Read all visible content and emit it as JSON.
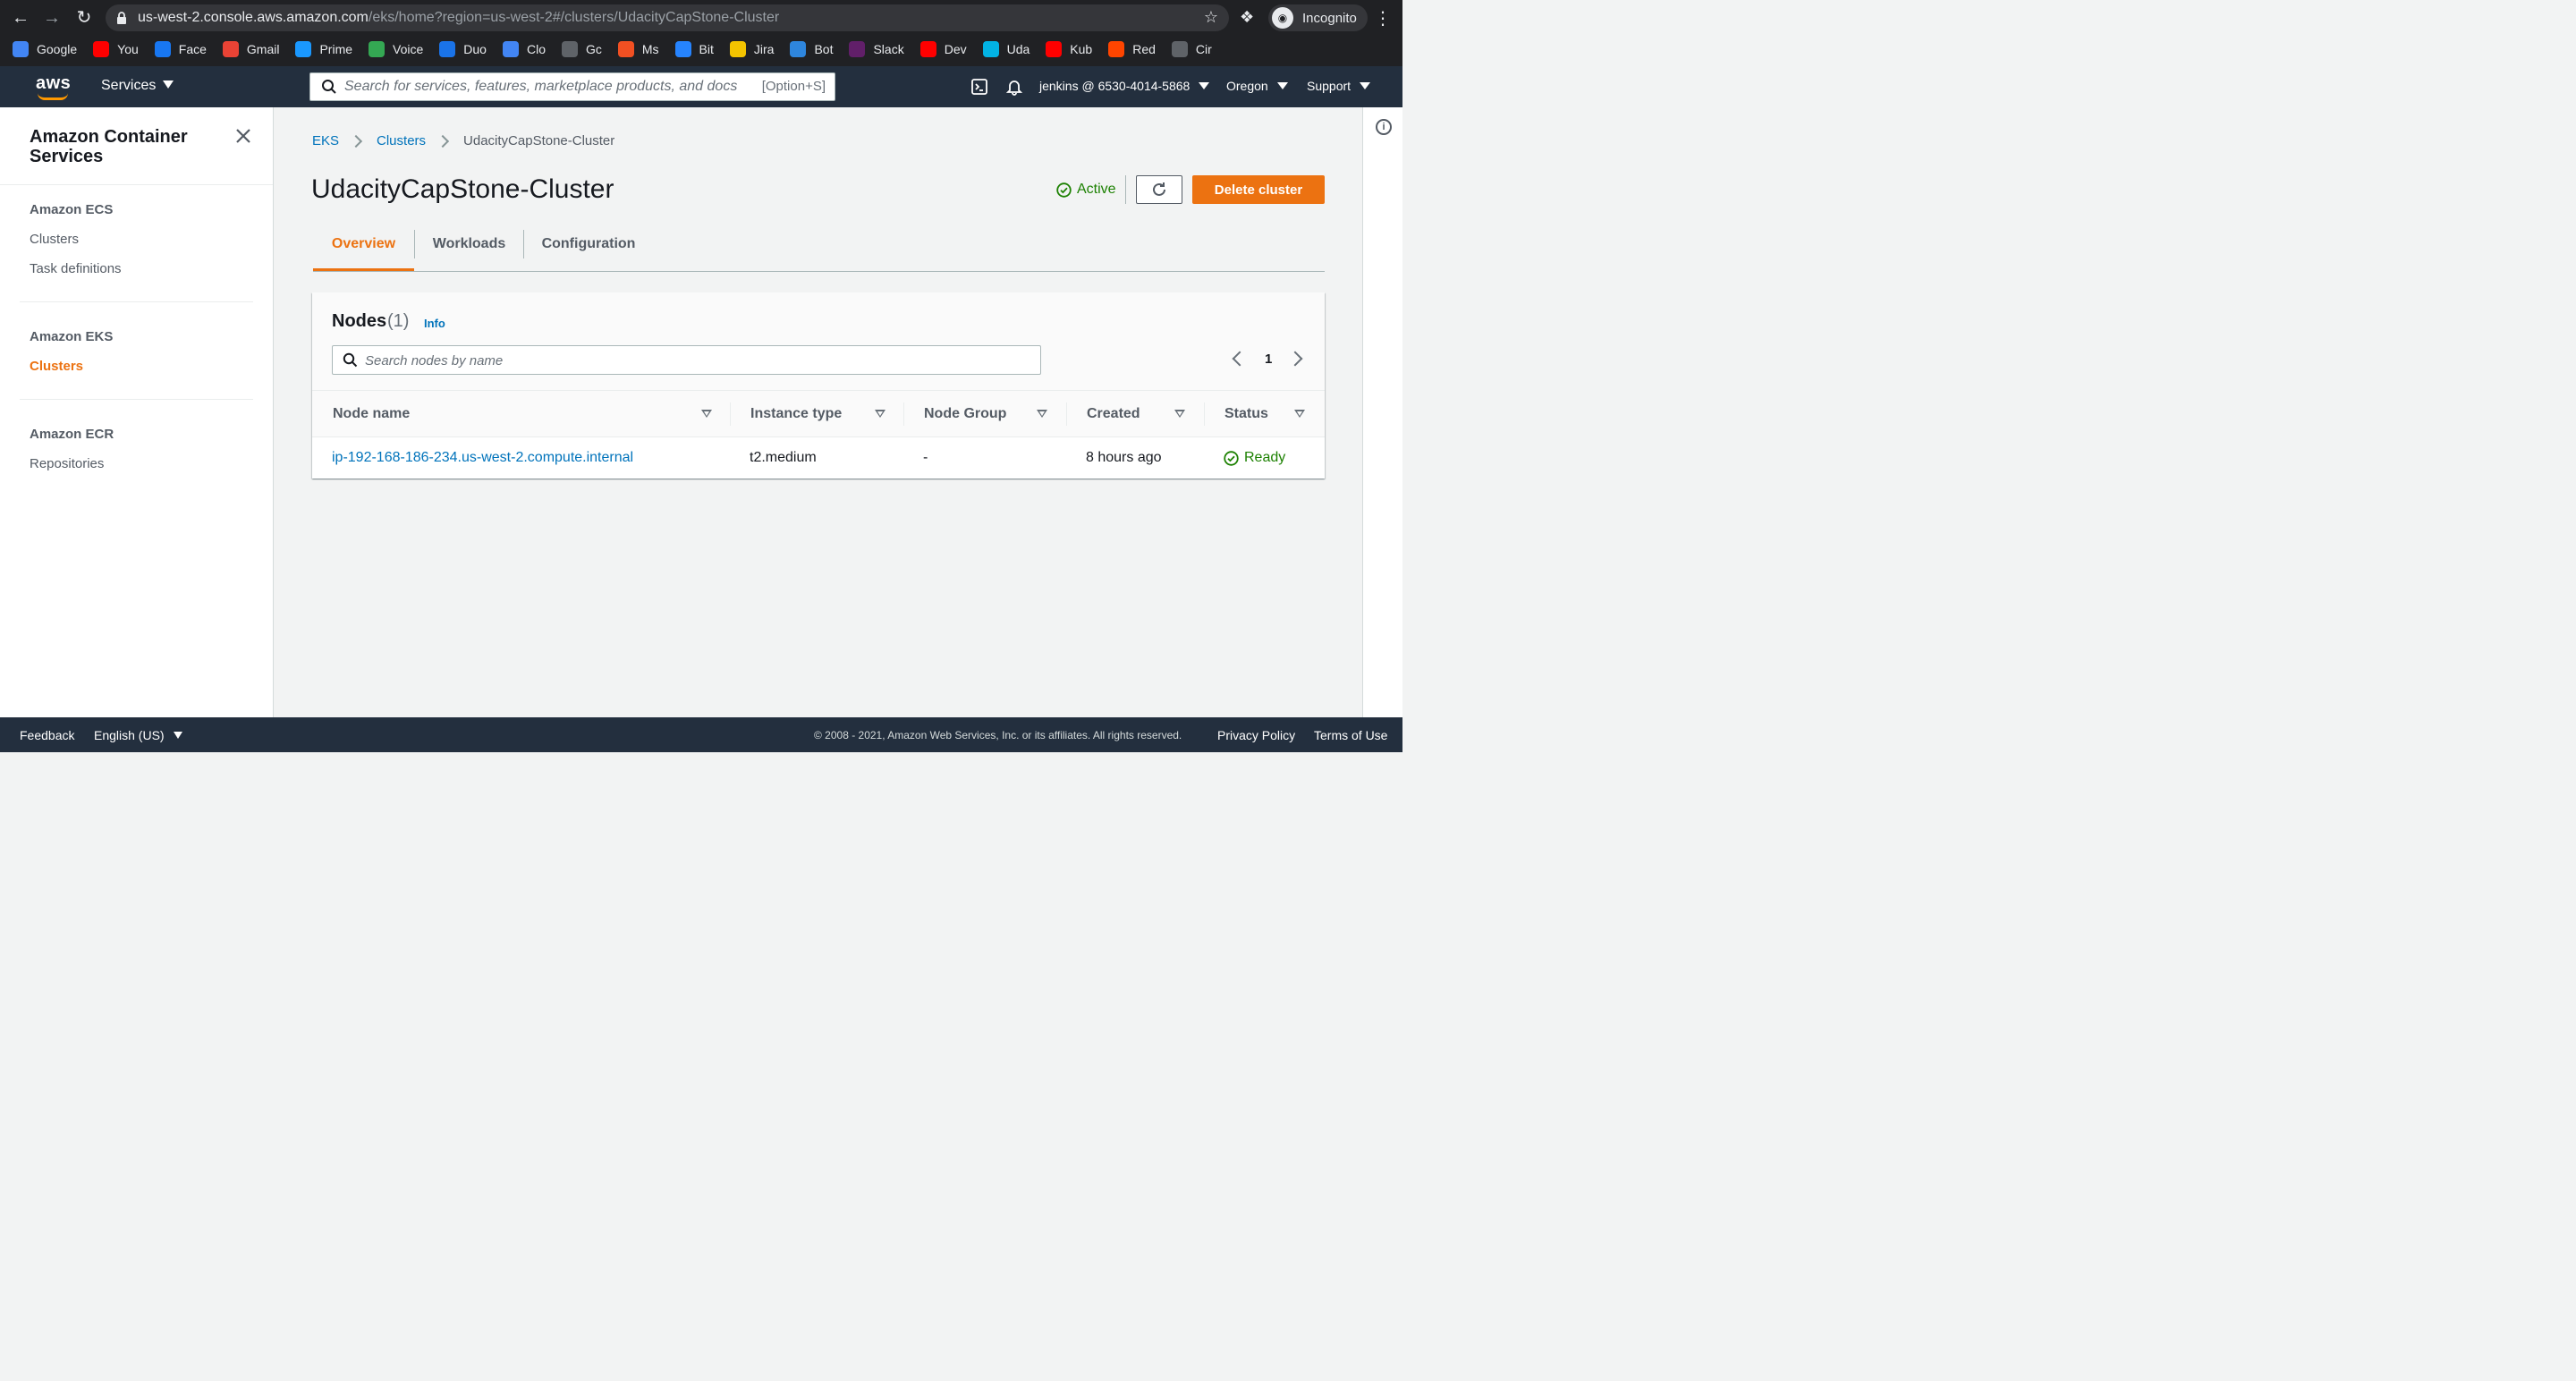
{
  "browser": {
    "url_host": "us-west-2.console.aws.amazon.com",
    "url_path": "/eks/home?region=us-west-2#/clusters/UdacityCapStone-Cluster",
    "incognito_label": "Incognito",
    "bookmarks": [
      {
        "label": "Google",
        "icon": "google-icon",
        "color": "#4285f4"
      },
      {
        "label": "You",
        "icon": "youtube-icon",
        "color": "#ff0000"
      },
      {
        "label": "Face",
        "icon": "facebook-icon",
        "color": "#1877f2"
      },
      {
        "label": "Gmail",
        "icon": "gmail-icon",
        "color": "#ea4335"
      },
      {
        "label": "Prime",
        "icon": "prime-icon",
        "color": "#1a98ff"
      },
      {
        "label": "Voice",
        "icon": "voice-icon",
        "color": "#34a853"
      },
      {
        "label": "Duo",
        "icon": "duo-icon",
        "color": "#1a73e8"
      },
      {
        "label": "Clo",
        "icon": "cloud-icon",
        "color": "#4285f4"
      },
      {
        "label": "Gc",
        "icon": "globe-icon",
        "color": "#5f6368"
      },
      {
        "label": "Ms",
        "icon": "microsoft-icon",
        "color": "#f25022"
      },
      {
        "label": "Bit",
        "icon": "bitbucket-icon",
        "color": "#2684ff"
      },
      {
        "label": "Jira",
        "icon": "jira-icon",
        "color": "#f4c400"
      },
      {
        "label": "Bot",
        "icon": "bot-icon",
        "color": "#2e86de"
      },
      {
        "label": "Slack",
        "icon": "slack-icon",
        "color": "#611f69"
      },
      {
        "label": "Dev",
        "icon": "youtube-icon",
        "color": "#ff0000"
      },
      {
        "label": "Uda",
        "icon": "udacity-icon",
        "color": "#02b3e4"
      },
      {
        "label": "Kub",
        "icon": "youtube-icon",
        "color": "#ff0000"
      },
      {
        "label": "Red",
        "icon": "reddit-icon",
        "color": "#ff4500"
      },
      {
        "label": "Cir",
        "icon": "circleci-icon",
        "color": "#5f6368"
      }
    ]
  },
  "aws_header": {
    "logo": "aws",
    "services_label": "Services",
    "search_placeholder": "Search for services, features, marketplace products, and docs",
    "search_shortcut": "[Option+S]",
    "account": "jenkins @ 6530-4014-5868",
    "region": "Oregon",
    "support": "Support"
  },
  "sidebar": {
    "title": "Amazon Container Services",
    "sections": [
      {
        "heading": "Amazon ECS",
        "items": [
          "Clusters",
          "Task definitions"
        ]
      },
      {
        "heading": "Amazon EKS",
        "items": [
          "Clusters"
        ]
      },
      {
        "heading": "Amazon ECR",
        "items": [
          "Repositories"
        ]
      }
    ]
  },
  "breadcrumb": [
    "EKS",
    "Clusters",
    "UdacityCapStone-Cluster"
  ],
  "page": {
    "title": "UdacityCapStone-Cluster",
    "status": "Active",
    "delete_label": "Delete cluster"
  },
  "tabs": [
    "Overview",
    "Workloads",
    "Configuration"
  ],
  "nodes": {
    "title": "Nodes",
    "count": "(1)",
    "info": "Info",
    "search_placeholder": "Search nodes by name",
    "page": "1",
    "columns": [
      "Node name",
      "Instance type",
      "Node Group",
      "Created",
      "Status"
    ],
    "rows": [
      {
        "name": "ip-192-168-186-234.us-west-2.compute.internal",
        "instance_type": "t2.medium",
        "node_group": "-",
        "created": "8 hours ago",
        "status": "Ready"
      }
    ]
  },
  "footer": {
    "feedback": "Feedback",
    "language": "English (US)",
    "copyright": "© 2008 - 2021, Amazon Web Services, Inc. or its affiliates. All rights reserved.",
    "privacy": "Privacy Policy",
    "terms": "Terms of Use"
  },
  "colors": {
    "accent": "#ec7211",
    "link": "#0073bb",
    "success": "#1d8102",
    "header_bg": "#232f3e"
  }
}
